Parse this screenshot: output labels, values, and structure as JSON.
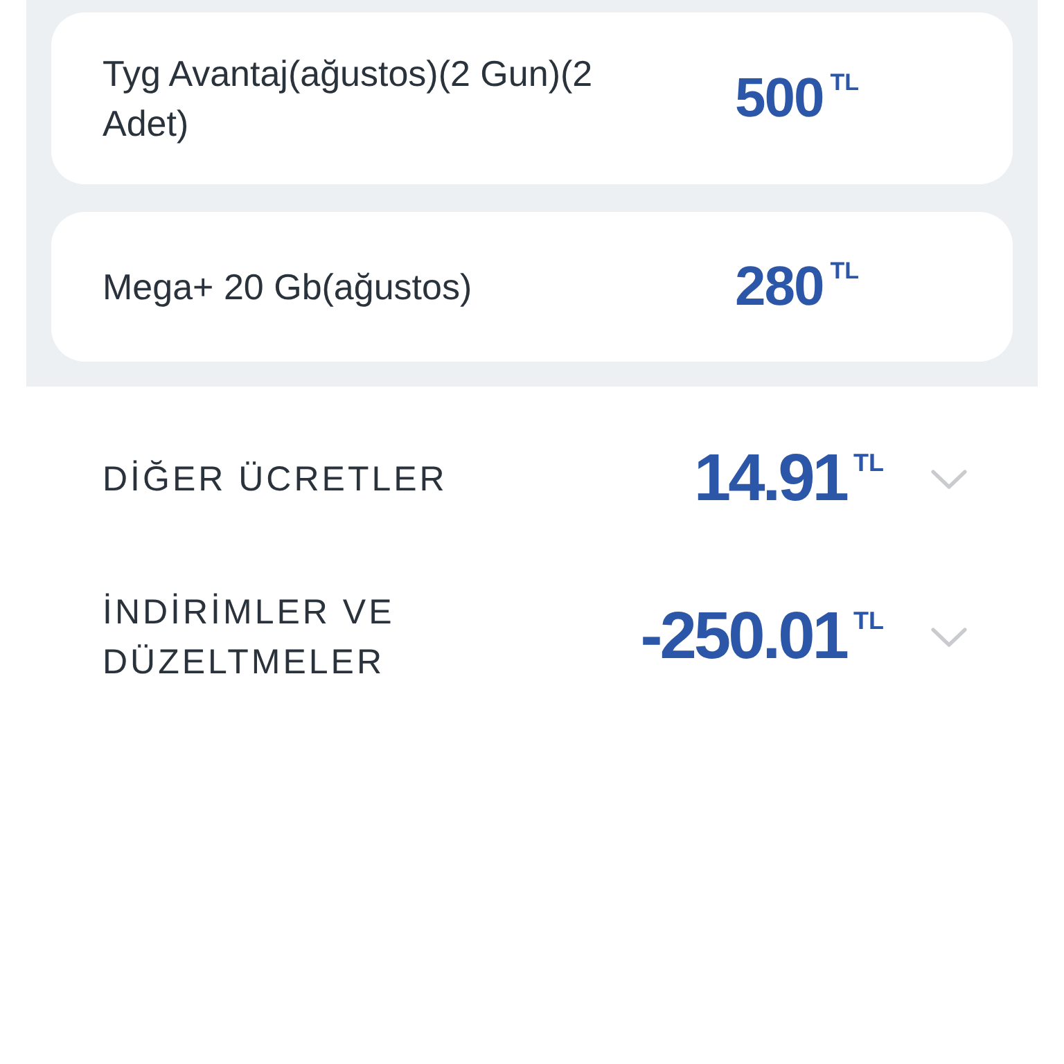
{
  "items": [
    {
      "name": "Tyg Avantaj(ağustos)(2 Gun)(2 Adet)",
      "amount": "500",
      "currency": "TL"
    },
    {
      "name": "Mega+ 20 Gb(ağustos)",
      "amount": "280",
      "currency": "TL"
    }
  ],
  "sections": [
    {
      "title": "DİĞER ÜCRETLER",
      "amount": "14.91",
      "currency": "TL",
      "expanded": false
    },
    {
      "title": "İNDİRİMLER VE DÜZELTMELER",
      "amount": "-250.01",
      "currency": "TL",
      "expanded": false
    }
  ]
}
